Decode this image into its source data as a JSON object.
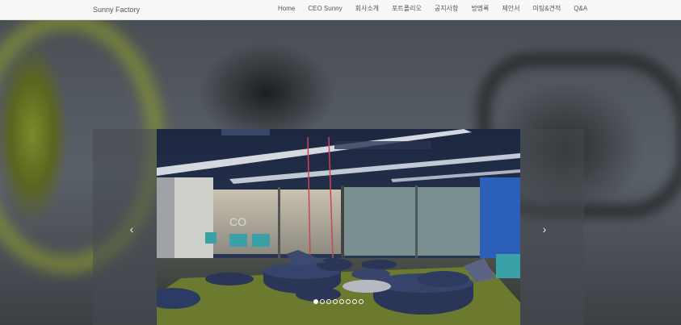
{
  "navbar": {
    "brand": "Sunny Factory",
    "items": [
      {
        "label": "Home"
      },
      {
        "label": "CEO Sunny"
      },
      {
        "label": "회사소개"
      },
      {
        "label": "포트폴리오"
      },
      {
        "label": "공지사항"
      },
      {
        "label": "방명록"
      },
      {
        "label": "제안서"
      },
      {
        "label": "미팅&견적"
      },
      {
        "label": "Q&A"
      }
    ]
  },
  "carousel": {
    "prev_icon": "chevron-left-icon",
    "next_icon": "chevron-right-icon",
    "prev_glyph": "‹",
    "next_glyph": "›",
    "slide_count": 8,
    "active_index": 0
  },
  "colors": {
    "navbar_bg": "#f8f8f8",
    "nav_text": "#555555",
    "carpet": "#6b7a2e",
    "pouf": "#2a3558"
  }
}
